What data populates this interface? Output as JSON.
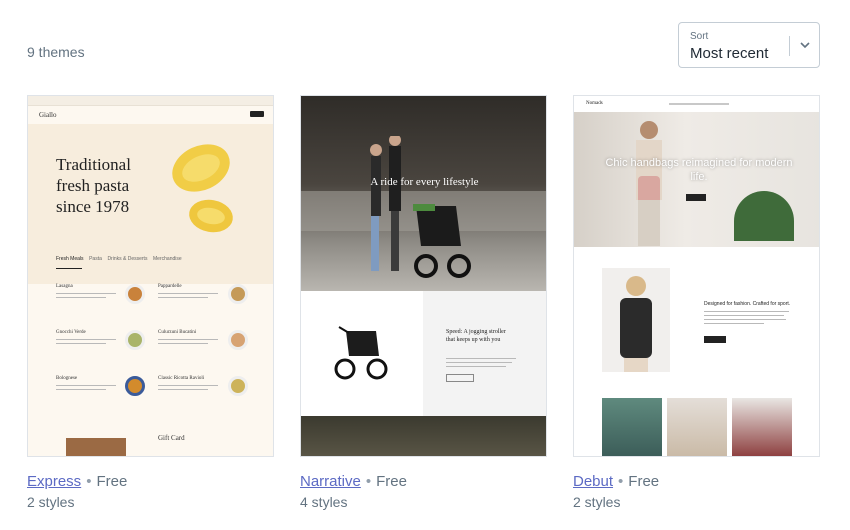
{
  "header": {
    "count_label": "9 themes"
  },
  "sort": {
    "label": "Sort",
    "value": "Most recent"
  },
  "themes": [
    {
      "name": "Express",
      "price": "Free",
      "styles": "2 styles",
      "preview": {
        "brand": "Giallo",
        "headline": [
          "Traditional",
          "fresh pasta",
          "since 1978"
        ],
        "tabs": [
          "Fresh Meals",
          "Pasta",
          "Drinks & Desserts",
          "Merchandise"
        ],
        "items": [
          "Lasagna",
          "Pappardelle",
          "Gnocchi Verde",
          "Culurzuni Bucatini",
          "Bolognese",
          "Classic Ricotta Ravioli"
        ],
        "footer_item": "Gift Card"
      }
    },
    {
      "name": "Narrative",
      "price": "Free",
      "styles": "4 styles",
      "preview": {
        "hero_text": "A ride for every lifestyle",
        "feature_title": "Speed: A jogging stroller that keeps up with you"
      }
    },
    {
      "name": "Debut",
      "price": "Free",
      "styles": "2 styles",
      "preview": {
        "brand": "Nomads",
        "hero_text": "Chic handbags reimagined for modern life.",
        "feature_title": "Designed for fashion. Crafted for sport."
      }
    }
  ],
  "colors": {
    "link": "#5c6ac4",
    "muted": "#637381",
    "border": "#dfe3e8"
  }
}
